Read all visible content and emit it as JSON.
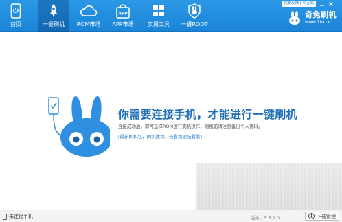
{
  "window": {
    "feedback_label": "我要反馈",
    "top_note": "我要反馈 | 非正式"
  },
  "nav": {
    "home": {
      "label": "首页",
      "icon": "phone-icon"
    },
    "flash": {
      "label": "一键刷机",
      "icon": "rocket-icon"
    },
    "rom": {
      "label": "ROM市场",
      "icon": "cloud-icon"
    },
    "app": {
      "label": "APP市场",
      "icon": "app-bag-icon",
      "badge": "APP"
    },
    "tools": {
      "label": "实用工具",
      "icon": "windows-grid-icon"
    },
    "root": {
      "label": "一键ROOT",
      "icon": "shield-rabbit-icon"
    }
  },
  "brand": {
    "name": "奇兔刷机",
    "url": "www.7to.cn"
  },
  "main": {
    "headline": "你需要连接手机，才能进行一键刷机",
    "description": "连接成功后，即可选择ROM进行刷机操作，刷机前请注意备份个人资料。",
    "links": "[最新刷机包，刷机教程，去看免论坛看看]"
  },
  "status": {
    "connection": "未连接手机",
    "version": "版本：5.5.2.0",
    "download_button": "下载管理"
  },
  "colors": {
    "topbar": "#1c84d6",
    "headline": "#1f6fb8",
    "mascot": "#2f8fe0"
  }
}
